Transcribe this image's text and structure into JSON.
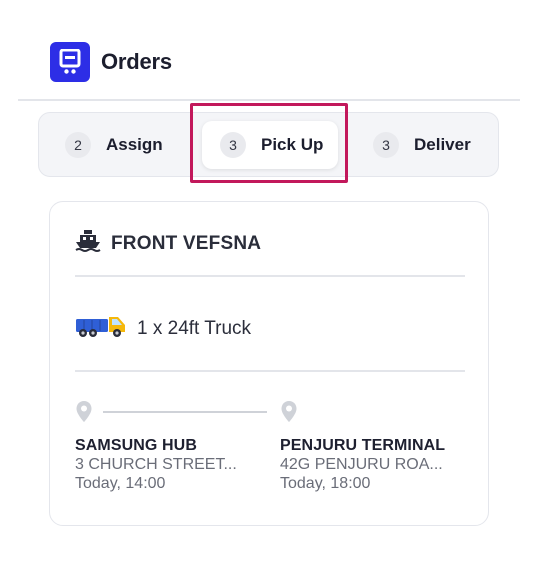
{
  "header": {
    "title": "Orders",
    "logo_icon": "truck-app-icon",
    "brand_color": "#2d2ee6"
  },
  "tabs": [
    {
      "count": "2",
      "label": "Assign"
    },
    {
      "count": "3",
      "label": "Pick Up",
      "active": true
    },
    {
      "count": "3",
      "label": "Deliver"
    }
  ],
  "highlight_color": "#c2185b",
  "order_card": {
    "vessel": {
      "icon": "ship-icon",
      "name": "FRONT VEFSNA"
    },
    "vehicle": {
      "icon": "truck-icon",
      "text": "1 x 24ft Truck"
    },
    "origin": {
      "icon": "location-pin-icon",
      "name": "SAMSUNG HUB",
      "address": "3 CHURCH STREET...",
      "time": "Today, 14:00"
    },
    "destination": {
      "icon": "location-pin-icon",
      "name": "PENJURU TERMINAL",
      "address": "42G PENJURU ROA...",
      "time": "Today, 18:00"
    }
  }
}
